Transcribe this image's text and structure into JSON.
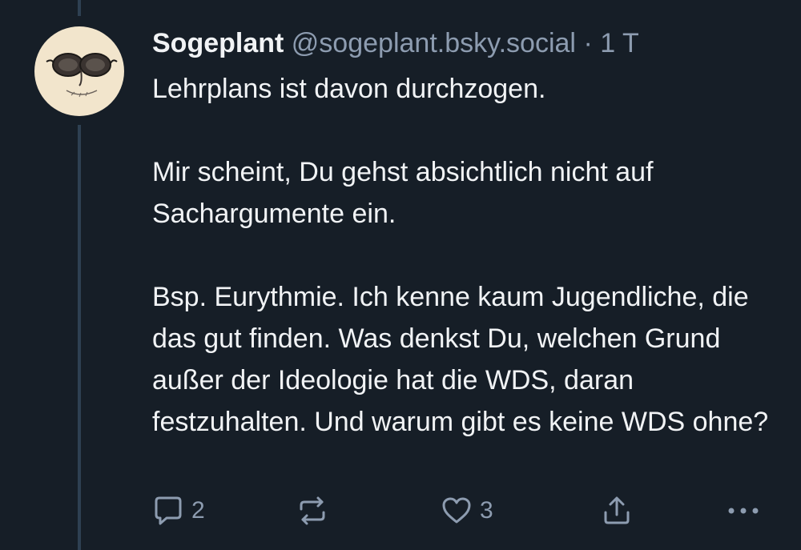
{
  "post": {
    "author_name": "Sogeplant",
    "author_handle": "@sogeplant.bsky.social",
    "separator": "·",
    "timestamp": "1 T",
    "paragraphs": [
      "Lehrplans ist davon durchzogen.",
      "Mir scheint, Du gehst absichtlich nicht auf Sachargumente ein.",
      "Bsp. Eurythmie. Ich kenne kaum Jugendliche, die das gut finden. Was denkst Du, welchen Grund außer der Ideologie hat die WDS, daran festzuhalten. Und warum gibt es keine WDS ohne?"
    ]
  },
  "actions": {
    "reply": {
      "icon": "speech-bubble-icon",
      "count": "2"
    },
    "repost": {
      "icon": "repost-arrows-icon"
    },
    "like": {
      "icon": "heart-icon",
      "count": "3"
    },
    "share": {
      "icon": "share-upload-icon"
    },
    "more": {
      "icon": "ellipsis-icon"
    }
  },
  "colors": {
    "background": "#161e27",
    "text_primary": "#f1f3f5",
    "text_secondary": "#8d9cb0",
    "thread_line": "#2e4052",
    "avatar_bg": "#f2e5cc"
  }
}
